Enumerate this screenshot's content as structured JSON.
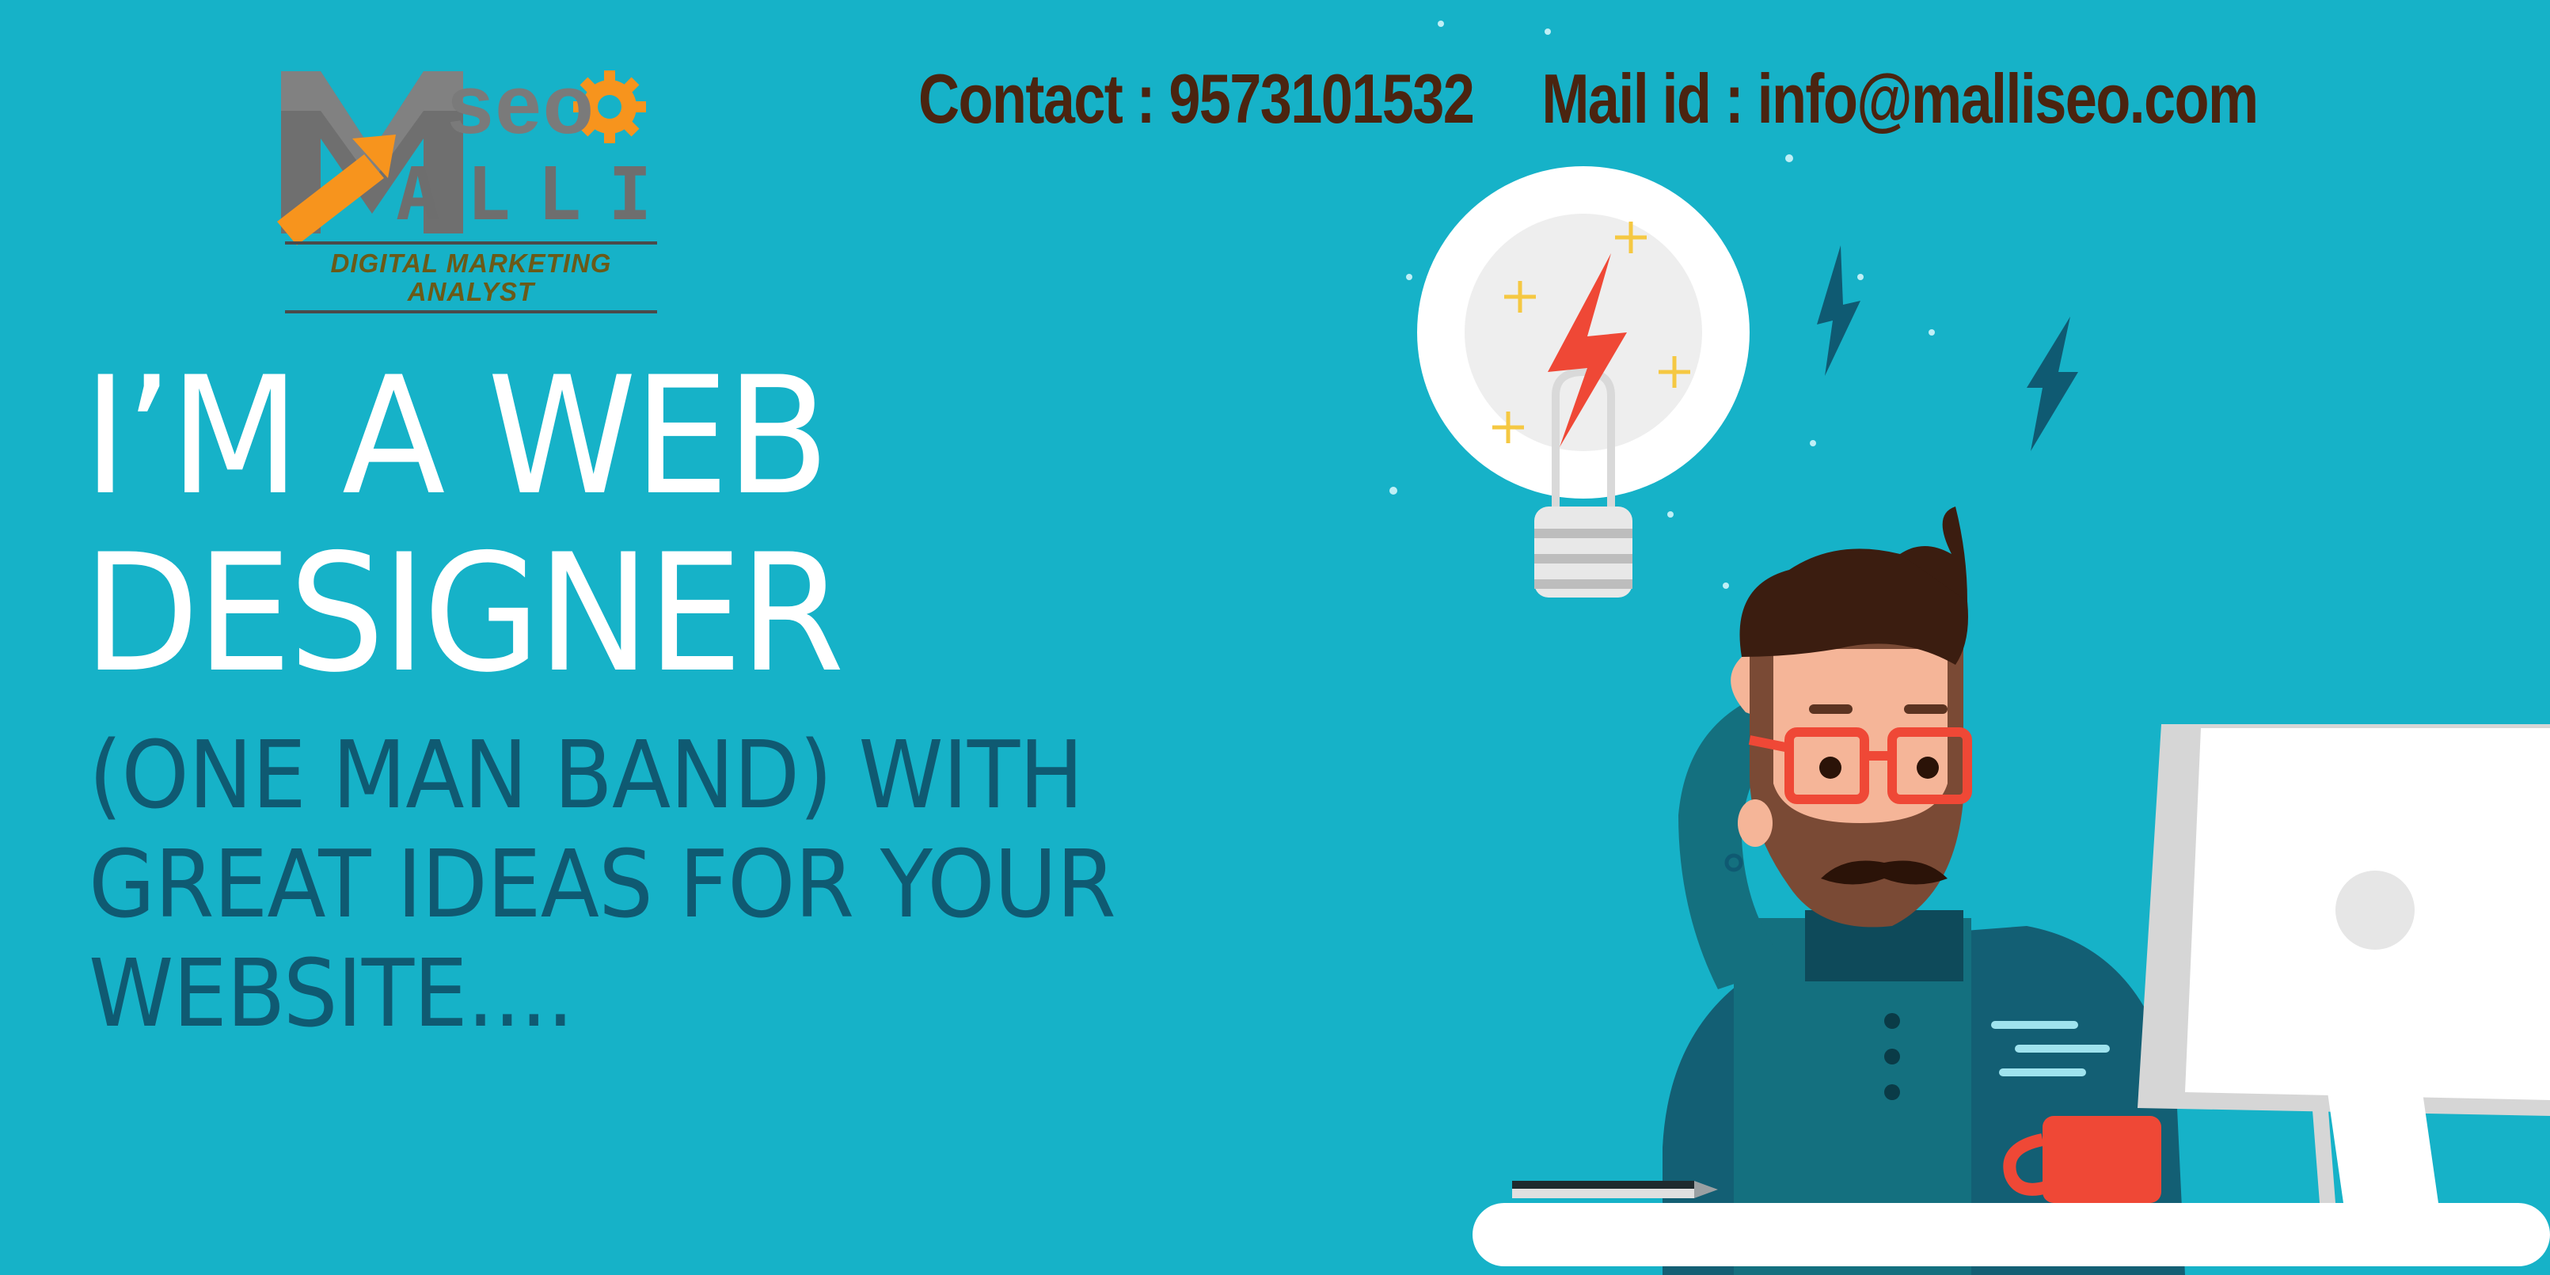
{
  "logo": {
    "mark_letter": "M",
    "seo_text": "seo",
    "name_text": "ALLI",
    "tagline": "DIGITAL MARKETING ANALYST"
  },
  "contact": {
    "phone": "Contact : 9573101532",
    "email": "Mail id : info@malliseo.com"
  },
  "headline": {
    "line1": "I’M A WEB",
    "line2": "DESIGNER"
  },
  "subline": {
    "line1": "(ONE MAN BAND) WITH",
    "line2": "GREAT IDEAS FOR YOUR",
    "line3": "WEBSITE...."
  },
  "colors": {
    "background": "#16b2c8",
    "contact_text": "#4a2410",
    "subline_text": "#0f5a72",
    "accent_orange": "#f7941d",
    "lightning_red": "#ef4836"
  },
  "icons": [
    "lightbulb-icon",
    "lightning-bolt-icon",
    "gear-icon",
    "coffee-cup-icon",
    "computer-monitor-icon",
    "pen-icon"
  ]
}
